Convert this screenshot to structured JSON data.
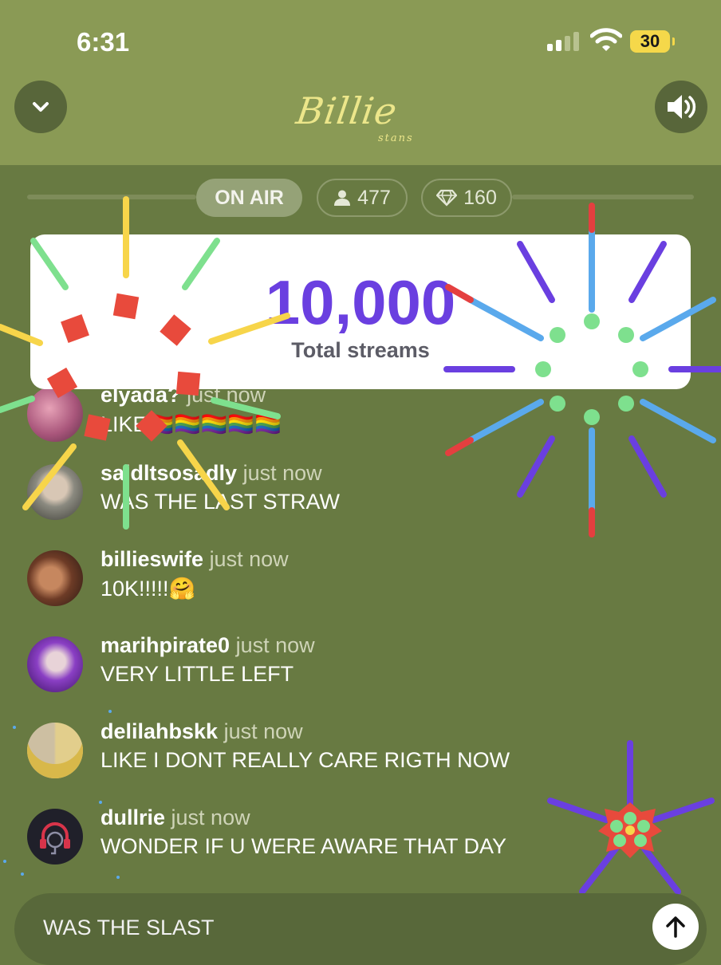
{
  "status_bar": {
    "time": "6:31",
    "battery": "30",
    "icons": [
      "signal-bars-icon",
      "wifi-icon",
      "battery-icon"
    ]
  },
  "header": {
    "logo_main": "Billie",
    "logo_sub": "stans",
    "left_button_icon": "chevron-down-icon",
    "right_button_icon": "speaker-icon"
  },
  "live_bar": {
    "on_air": "ON AIR",
    "viewers": "477",
    "diamonds": "160"
  },
  "stat_card": {
    "value": "10,000",
    "label": "Total streams"
  },
  "messages": [
    {
      "user": "elyada?",
      "time": "just now",
      "text": "LIKE🏳️‍🌈🏳️‍🌈🏳️‍🌈🏳️‍🌈🏳️‍🌈"
    },
    {
      "user": "saidltsosadly",
      "time": "just now",
      "text": "WAS THE LAST STRAW"
    },
    {
      "user": "billieswife",
      "time": "just now",
      "text": "10K!!!!!🤗"
    },
    {
      "user": "marihpirate0",
      "time": "just now",
      "text": "VERY LITTLE LEFT"
    },
    {
      "user": "delilahbskk",
      "time": "just now",
      "text": "LIKE I DONT REALLY CARE RIGTH NOW"
    },
    {
      "user": "dullrie",
      "time": "just now",
      "text": "WONDER IF U WERE AWARE THAT DAY"
    }
  ],
  "composer": {
    "value": "WAS THE SLAST",
    "send_icon": "arrow-up-icon"
  },
  "colors": {
    "header_bg": "#8a9a55",
    "body_bg": "#687a42",
    "accent_purple": "#6a3fe0",
    "battery_yellow": "#f5d84a"
  }
}
